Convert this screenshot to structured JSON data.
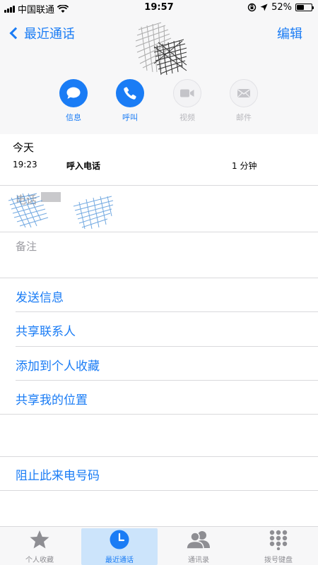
{
  "status_bar": {
    "carrier": "中国联通",
    "time": "19:57",
    "battery": "52%",
    "battery_level": 0.52
  },
  "nav": {
    "back_label": "最近通话",
    "edit_label": "编辑"
  },
  "actions": [
    {
      "label": "信息",
      "icon": "message-icon",
      "enabled": true
    },
    {
      "label": "呼叫",
      "icon": "phone-icon",
      "enabled": true
    },
    {
      "label": "视频",
      "icon": "video-icon",
      "enabled": false
    },
    {
      "label": "邮件",
      "icon": "mail-icon",
      "enabled": false
    }
  ],
  "recent": {
    "title": "今天",
    "time": "19:23",
    "type": "呼入电话",
    "duration": "1 分钟"
  },
  "fields": {
    "phone_label": "电话",
    "notes_label": "备注"
  },
  "menu": {
    "send_message": "发送信息",
    "share_contact": "共享联系人",
    "add_favorite": "添加到个人收藏",
    "share_location": "共享我的位置",
    "block_caller": "阻止此来电号码"
  },
  "tabs": [
    {
      "label": "个人收藏",
      "icon": "star-icon"
    },
    {
      "label": "最近通话",
      "icon": "clock-icon"
    },
    {
      "label": "通讯录",
      "icon": "contacts-icon"
    },
    {
      "label": "拨号键盘",
      "icon": "keypad-icon"
    }
  ],
  "colors": {
    "accent": "#1a7cf5",
    "disabled": "#b8b8bd",
    "tab_selected_bg": "#cce4fb"
  }
}
